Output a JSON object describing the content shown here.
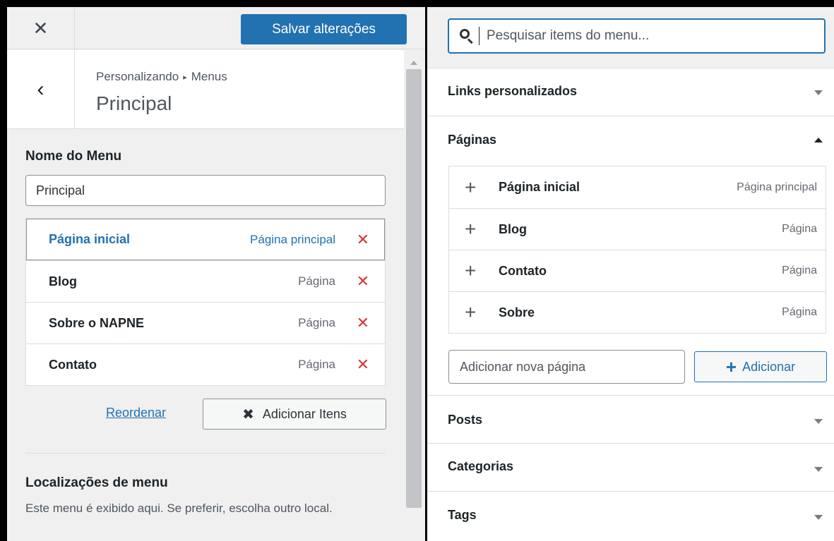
{
  "topbar": {
    "close_glyph": "✕",
    "save_label": "Salvar alterações"
  },
  "header": {
    "back_glyph": "‹",
    "breadcrumb_root": "Personalizando",
    "breadcrumb_sep": "▸",
    "breadcrumb_current": "Menus",
    "title": "Principal"
  },
  "menu_name": {
    "label": "Nome do Menu",
    "value": "Principal"
  },
  "menu_items": [
    {
      "title": "Página inicial",
      "type": "Página principal",
      "remove": "✕"
    },
    {
      "title": "Blog",
      "type": "Página",
      "remove": "✕"
    },
    {
      "title": "Sobre o NAPNE",
      "type": "Página",
      "remove": "✕"
    },
    {
      "title": "Contato",
      "type": "Página",
      "remove": "✕"
    }
  ],
  "actions": {
    "reorder_label": "Reordenar",
    "add_items_icon": "✖",
    "add_items_label": "Adicionar Itens"
  },
  "locations": {
    "title": "Localizações de menu",
    "description": "Este menu é exibido aqui. Se preferir, escolha outro local."
  },
  "search": {
    "placeholder": "Pesquisar items do menu..."
  },
  "sections": {
    "custom_links": "Links personalizados",
    "pages": "Páginas",
    "posts": "Posts",
    "categories": "Categorias",
    "tags": "Tags"
  },
  "pages": [
    {
      "title": "Página inicial",
      "type": "Página principal"
    },
    {
      "title": "Blog",
      "type": "Página"
    },
    {
      "title": "Contato",
      "type": "Página"
    },
    {
      "title": "Sobre",
      "type": "Página"
    }
  ],
  "new_page": {
    "placeholder": "Adicionar nova página",
    "add_icon": "+",
    "add_label": "Adicionar"
  },
  "colors": {
    "accent": "#2271b1",
    "remove": "#d63638",
    "panel_bg": "#f0f0f1"
  }
}
